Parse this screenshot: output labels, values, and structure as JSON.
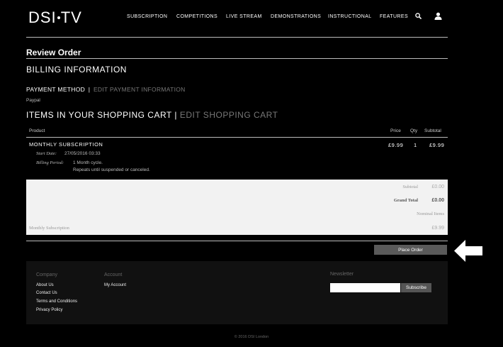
{
  "header": {
    "logo_left": "DSI",
    "logo_right": "TV",
    "nav": [
      "SUBSCRIPTION",
      "COMPETITIONS",
      "LIVE STREAM",
      "DEMONSTRATIONS",
      "INSTRUCTIONAL",
      "FEATURES"
    ]
  },
  "page": {
    "title": "Review Order",
    "billing_heading": "BILLING INFORMATION",
    "payment_method_label": "PAYMENT METHOD",
    "separator": "|",
    "edit_payment_label": "EDIT PAYMENT INFORMATION",
    "payment_value": "Paypal",
    "cart_heading": "ITEMS IN YOUR SHOPPING CART",
    "edit_cart_label": "EDIT SHOPPING CART"
  },
  "cart_table": {
    "headers": {
      "product": "Product",
      "price": "Price",
      "qty": "Qty",
      "subtotal": "Subtotal"
    },
    "item": {
      "name": "MONTHLY SUBSCRIPTION",
      "price": "£9.99",
      "qty": "1",
      "subtotal": "£9.99",
      "start_date_label": "Start Date:",
      "start_date_value": "27/05/2016 03:33",
      "billing_period_label": "Billing Period:",
      "billing_period_value": "1 Month cycle.",
      "billing_period_note": "Repeats until suspended or canceled."
    }
  },
  "totals": {
    "subtotal_label": "Subtotal",
    "subtotal_value": "£0.00",
    "grand_total_label": "Grand Total",
    "grand_total_value": "£0.00",
    "nominal_items_label": "Nominal Items",
    "nominal_row_label": "Monthly Subscription",
    "nominal_row_value": "£9.99"
  },
  "actions": {
    "place_order_label": "Place Order"
  },
  "footer": {
    "company_heading": "Company",
    "company_links": [
      "About Us",
      "Contact Us",
      "Terms and Conditions",
      "Privacy Policy"
    ],
    "account_heading": "Account",
    "account_links": [
      "My Account"
    ],
    "newsletter_heading": "Newsletter",
    "subscribe_label": "Subscribe",
    "copyright": "© 2016 DSI London"
  },
  "colors": {
    "background": "#000000",
    "totals_panel": "#f2f2f2",
    "button": "#5a5a5a",
    "muted_text": "#777777"
  },
  "icons": [
    "search-icon",
    "user-icon",
    "arrow-left-icon"
  ]
}
